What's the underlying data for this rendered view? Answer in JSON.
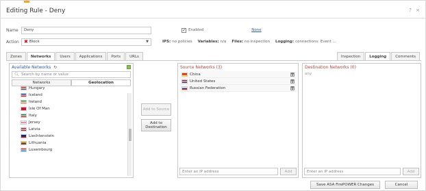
{
  "window": {
    "title": "Editing Rule - Deny",
    "help_icon": "?",
    "close_icon": "×"
  },
  "form": {
    "name_label": "Name",
    "name_value": "Deny",
    "enabled_label": "Enabled",
    "enabled_checked": "✓",
    "none_link": "None",
    "action_label": "Action",
    "action_value": "Block",
    "ips_label": "IPS:",
    "ips_value": "no policies",
    "variables_label": "Variables:",
    "variables_value": "n/a",
    "files_label": "Files:",
    "files_value": "no inspection",
    "logging_label": "Logging:",
    "logging_value": "connections: Event ..."
  },
  "tabs_left": [
    "Zones",
    "Networks",
    "Users",
    "Applications",
    "Ports",
    "URLs"
  ],
  "tabs_left_active": "Networks",
  "tabs_right": [
    "Inspection",
    "Logging",
    "Comments"
  ],
  "tabs_right_active": "Logging",
  "available": {
    "title": "Available Networks",
    "search_placeholder": "Search by name or value",
    "tab_networks": "Networks",
    "tab_geolocation": "Geolocation",
    "countries": [
      {
        "name": "Hungary",
        "flag": [
          "#cd2a3e",
          "#ffffff",
          "#436f4d"
        ]
      },
      {
        "name": "Iceland",
        "flag": [
          "#02529c",
          "#ffffff",
          "#dc1e35"
        ]
      },
      {
        "name": "Ireland",
        "flag": [
          "#169b62",
          "#ffffff",
          "#ff883e"
        ]
      },
      {
        "name": "Isle Of Man",
        "flag": [
          "#cf142b",
          "#cf142b",
          "#cf142b"
        ]
      },
      {
        "name": "Italy",
        "flag": [
          "#009246",
          "#ffffff",
          "#ce2b37"
        ]
      },
      {
        "name": "Jersey",
        "flag": [
          "#ffffff",
          "#e8112d",
          "#ffffff"
        ]
      },
      {
        "name": "Latvia",
        "flag": [
          "#9e3039",
          "#ffffff",
          "#9e3039"
        ]
      },
      {
        "name": "Liechtenstein",
        "flag": [
          "#002b7f",
          "#002b7f",
          "#ce1126"
        ]
      },
      {
        "name": "Lithuania",
        "flag": [
          "#fdb913",
          "#006a44",
          "#c1272d"
        ]
      },
      {
        "name": "Luxembourg",
        "flag": [
          "#ed2939",
          "#ffffff",
          "#00a1de"
        ]
      }
    ]
  },
  "buttons": {
    "add_to_source": "Add to Source",
    "add_to_destination": "Add to Destination",
    "add_src": "Add",
    "add_dst": "Add",
    "save": "Save ASA FirePOWER Changes",
    "cancel": "Cancel"
  },
  "source": {
    "title": "Source Networks (3)",
    "items": [
      {
        "name": "China",
        "flag": [
          "#de2910",
          "#de2910",
          "#ffde00"
        ]
      },
      {
        "name": "United States",
        "flag": [
          "#b22234",
          "#ffffff",
          "#3c3b6e"
        ]
      },
      {
        "name": "Russian Federation",
        "flag": [
          "#ffffff",
          "#0039a6",
          "#d52b1e"
        ]
      }
    ],
    "ip_placeholder": "Enter an IP address"
  },
  "destination": {
    "title": "Destination Networks (0)",
    "any": "any",
    "ip_placeholder": "Enter an IP address"
  },
  "colors": {
    "accent": "#f5a623",
    "pane_title": "#b5473a",
    "link": "#2a5db0",
    "block_icon": "#d0021b"
  }
}
